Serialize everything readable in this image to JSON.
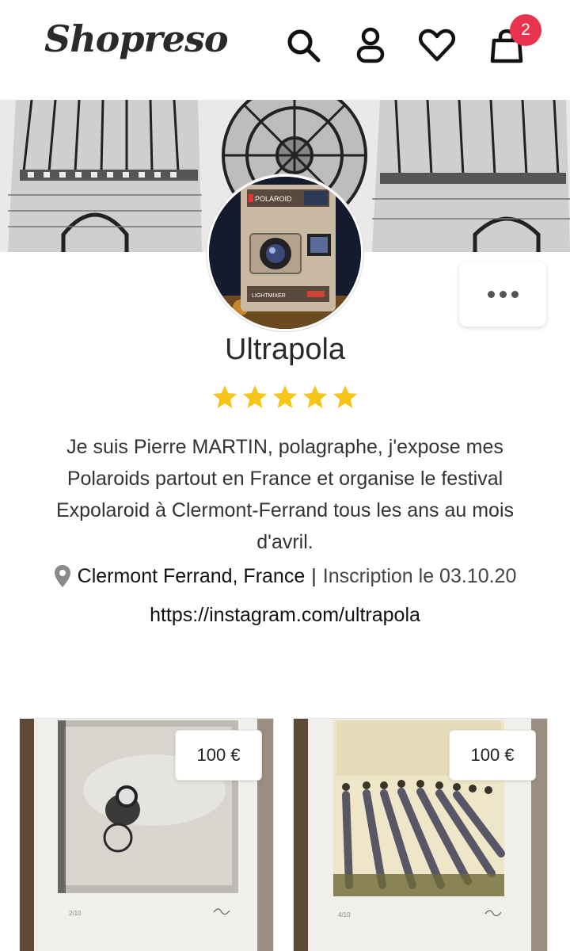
{
  "header": {
    "logo": "Shopreso",
    "icons": [
      "search-icon",
      "user-icon",
      "heart-icon",
      "bag-icon"
    ],
    "cart_count": "2"
  },
  "profile": {
    "name": "Ultrapola",
    "rating": 5,
    "bio": "Je suis Pierre MARTIN, polagraphe, j'expose mes Polaroids partout en France et organise le festival Expolaroid à Clermont-Ferrand tous les ans au mois d'avril.",
    "location": "Clermont Ferrand, France",
    "separator": "|",
    "joined": "Inscription le 03.10.20",
    "link": "https://instagram.com/ultrapola",
    "avatar_camera_label": "POLAROID",
    "avatar_camera_sublabel": "LIGHTMIXER"
  },
  "products": [
    {
      "price": "100 €"
    },
    {
      "price": "100 €"
    }
  ],
  "colors": {
    "badge": "#e8344e",
    "star": "#f5c518",
    "text": "#2a2a2a"
  }
}
